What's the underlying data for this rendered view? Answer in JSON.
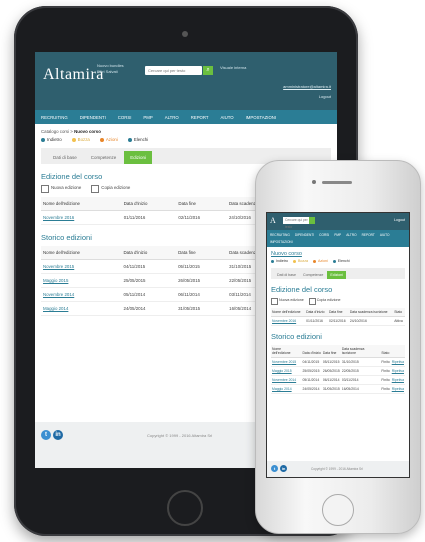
{
  "colors": {
    "header": "#2f5f6e",
    "nav": "#2b7d95",
    "accent_green": "#6bbf3f",
    "link": "#2b7d95"
  },
  "app": {
    "logo": "Altamira",
    "user_lines": [
      "Nuovo bundles",
      "Filtri Salvati"
    ],
    "search_placeholder": "Cercare qui per testo",
    "visual_label": "Visuale interna",
    "email": "amministratore@altamira.it",
    "logout": "Logout"
  },
  "nav": [
    "RECRUITING",
    "DIPENDENTI",
    "CORSI",
    "PMP",
    "ALTRO",
    "REPORT",
    "AIUTO",
    "IMPOSTAZIONI"
  ],
  "breadcrumb": {
    "prefix": "Catalogo corsi >",
    "current": "Nuovo corso"
  },
  "status_legend": [
    {
      "label": "Indietro",
      "color": "#2b7d95"
    },
    {
      "label": "Bozza",
      "color": "#f2c14e"
    },
    {
      "label": "Azioni",
      "color": "#e8862a"
    },
    {
      "label": "Elenchi",
      "color": "#2b7d95"
    }
  ],
  "tabs": [
    "Dati di base",
    "Competenze",
    "Edizioni"
  ],
  "active_tab": "Edizioni",
  "edizione": {
    "title": "Edizione del corso",
    "actions": [
      {
        "icon": "new-edition-icon",
        "label": "Nuova edizione"
      },
      {
        "icon": "copy-edition-icon",
        "label": "Copia edizione"
      }
    ],
    "columns": [
      "Nome dell'edizione",
      "Data d'inizio",
      "Data fine",
      "Data scadenza iscrizione",
      "Stato"
    ],
    "rows": [
      [
        "Novembre 2016",
        "01/11/2016",
        "02/11/2016",
        "24/10/2016",
        "Attiva"
      ]
    ]
  },
  "storico": {
    "title": "Storico edizioni",
    "columns": [
      "Nome dell'edizione",
      "Data d'inizio",
      "Data fine",
      "Data scadenza iscrizione"
    ],
    "rows": [
      [
        "Novembre 2015",
        "04/11/2015",
        "05/11/2015",
        "31/10/2015"
      ],
      [
        "Maggio 2015",
        "25/05/2015",
        "26/05/2015",
        "22/05/2015"
      ],
      [
        "Novembre 2014",
        "05/11/2014",
        "06/11/2014",
        "03/11/2014"
      ],
      [
        "Maggio 2014",
        "24/05/2014",
        "31/05/2015",
        "16/05/2014"
      ]
    ],
    "phone_extra_columns": [
      "Stato",
      ""
    ],
    "phone_extra_values": [
      "Finito",
      "Ripetiva"
    ]
  },
  "footer": {
    "copyright": "Copyright © 1999 - 2016 Altamira Srl",
    "social": [
      "t",
      "in"
    ]
  }
}
